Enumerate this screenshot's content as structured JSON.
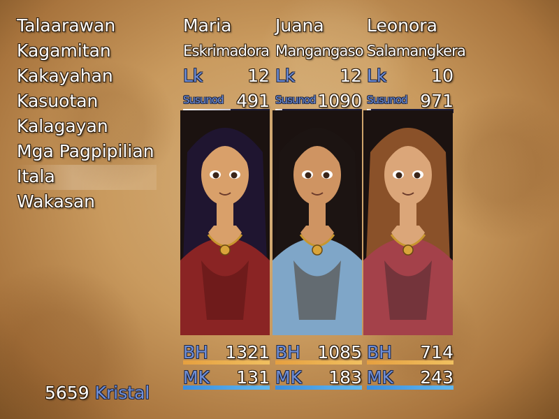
{
  "menu": {
    "items": [
      {
        "label": "Talaarawan"
      },
      {
        "label": "Kagamitan"
      },
      {
        "label": "Kakayahan"
      },
      {
        "label": "Kasuotan"
      },
      {
        "label": "Kalagayan"
      },
      {
        "label": "Mga Pagpipilian"
      },
      {
        "label": "Itala"
      },
      {
        "label": "Wakasan"
      }
    ],
    "selected_index": 6
  },
  "gold": {
    "amount": "5659",
    "unit": "Kristal"
  },
  "labels": {
    "level": "Lk",
    "exp": "Susunod",
    "hp": "BH",
    "mp": "MK"
  },
  "party": [
    {
      "name": "Maria",
      "class": "Eskrimadora",
      "level": "12",
      "next_exp": "491",
      "exp_fill": 0.55,
      "hp": "1321",
      "hp_fill": 1.0,
      "mp": "131",
      "mp_fill": 1.0,
      "colors": {
        "skin": "#d9a06a",
        "hair": "#1f1530",
        "top": "#8a2424",
        "accent": "#5a1414"
      }
    },
    {
      "name": "Juana",
      "class": "Mangangaso",
      "level": "12",
      "next_exp": "1090",
      "exp_fill": 0.08,
      "hp": "1085",
      "hp_fill": 1.0,
      "mp": "183",
      "mp_fill": 1.0,
      "colors": {
        "skin": "#cf9462",
        "hair": "#1c1412",
        "top": "#7fa6c8",
        "accent": "#4d3a2a"
      }
    },
    {
      "name": "Leonora",
      "class": "Salamangkera",
      "level": "10",
      "next_exp": "971",
      "exp_fill": 0.05,
      "hp": "714",
      "hp_fill": 1.0,
      "mp": "243",
      "mp_fill": 1.0,
      "colors": {
        "skin": "#dba679",
        "hair": "#8a5129",
        "top": "#a4414a",
        "accent": "#4c2a2f"
      }
    }
  ]
}
